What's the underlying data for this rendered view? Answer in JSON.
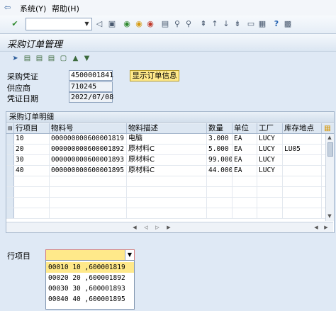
{
  "menu": {
    "items": [
      "系统(Y)",
      "帮助(H)"
    ]
  },
  "toolbar": {
    "command_value": ""
  },
  "title": "采购订单管理",
  "fields": {
    "po_label": "采购凭证",
    "po_value": "4500001841",
    "vendor_label": "供应商",
    "vendor_value": "710245",
    "date_label": "凭证日期",
    "date_value": "2022/07/08",
    "show_button": "显示订单信息"
  },
  "table": {
    "caption": "采购订单明细",
    "headers": [
      "行项目",
      "物料号",
      "物料描述",
      "数量",
      "单位",
      "工厂",
      "库存地点"
    ],
    "rows": [
      [
        "10",
        "000000000600001819",
        "电脑",
        "3.000",
        "EA",
        "LUCY",
        ""
      ],
      [
        "20",
        "000000000600001892",
        "原材料C",
        "5.000",
        "EA",
        "LUCY",
        "LU05"
      ],
      [
        "30",
        "000000000600001893",
        "原材料C",
        "99.000",
        "EA",
        "LUCY",
        ""
      ],
      [
        "40",
        "000000000600001895",
        "原材料C",
        "44.000",
        "EA",
        "LUCY",
        ""
      ]
    ]
  },
  "item_select": {
    "label": "行项目",
    "value": "",
    "options": [
      "00010 10  ,600001819",
      "00020 20  ,600001892",
      "00030 30  ,600001893",
      "00040 40  ,600001895"
    ]
  }
}
